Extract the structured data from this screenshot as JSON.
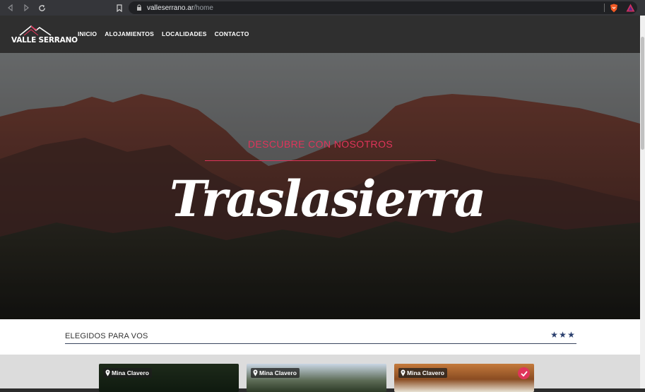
{
  "browser": {
    "url_host": "valleserrano.ar",
    "url_path": "/home"
  },
  "site": {
    "logo_text": "VALLE SERRANO",
    "menu": [
      {
        "label": "INICIO"
      },
      {
        "label": "ALOJAMIENTOS"
      },
      {
        "label": "LOCALIDADES"
      },
      {
        "label": "CONTACTO"
      }
    ]
  },
  "hero": {
    "subtitle": "DESCUBRE CON NOSOTROS",
    "title": "Traslasierra"
  },
  "section": {
    "title": "ELEGIDOS PARA VOS",
    "stars": 3
  },
  "cards": [
    {
      "location": "Mina Clavero"
    },
    {
      "location": "Mina Clavero"
    },
    {
      "location": "Mina Clavero"
    }
  ],
  "colors": {
    "accent": "#e0345a",
    "header_bg": "#2f2f2f",
    "star": "#2a3f6e"
  }
}
